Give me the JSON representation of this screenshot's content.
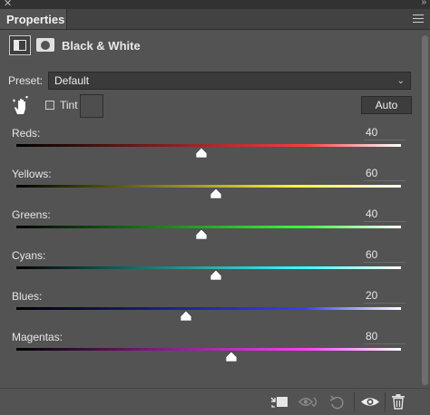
{
  "panel": {
    "tab_title": "Properties",
    "adjustment_title": "Black & White"
  },
  "preset": {
    "label": "Preset:",
    "value": "Default"
  },
  "tint": {
    "label": "Tint",
    "checked": false,
    "auto_label": "Auto"
  },
  "sliders": [
    {
      "label": "Reds:",
      "value": "40",
      "gradient_end": "#ff3b3b"
    },
    {
      "label": "Yellows:",
      "value": "60",
      "gradient_end": "#ffff3b"
    },
    {
      "label": "Greens:",
      "value": "40",
      "gradient_end": "#3bff3b"
    },
    {
      "label": "Cyans:",
      "value": "60",
      "gradient_end": "#3bffff"
    },
    {
      "label": "Blues:",
      "value": "20",
      "gradient_end": "#3b3bff"
    },
    {
      "label": "Magentas:",
      "value": "80",
      "gradient_end": "#ff3bff"
    }
  ],
  "icons": {
    "close": "close-icon",
    "collapse": "collapse-icon",
    "panel_menu": "panel-menu-icon",
    "adjustment": "black-white-adjustment-icon",
    "mask": "layer-mask-icon",
    "targeted_adjustment": "targeted-adjustment-hand-icon",
    "clip_to_layer": "clip-to-layer-icon",
    "view_previous": "view-previous-state-icon",
    "reset": "reset-icon",
    "visibility": "eye-icon",
    "delete": "trash-icon"
  }
}
